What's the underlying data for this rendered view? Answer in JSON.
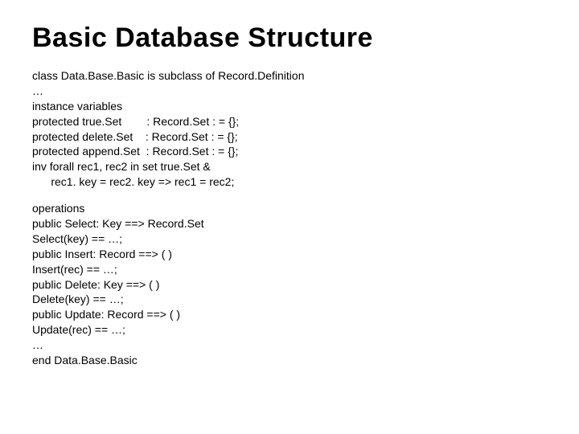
{
  "title": "Basic Database Structure",
  "block1": "class Data.Base.Basic is subclass of Record.Definition\n…\ninstance variables\nprotected true.Set        : Record.Set : = {};\nprotected delete.Set    : Record.Set : = {};\nprotected append.Set  : Record.Set : = {};\ninv forall rec1, rec2 in set true.Set &\n      rec1. key = rec2. key => rec1 = rec2;",
  "block2": "operations\npublic Select: Key ==> Record.Set\nSelect(key) == …;\npublic Insert: Record ==> ( )\nInsert(rec) == …;\npublic Delete: Key ==> ( )\nDelete(key) == …;\npublic Update: Record ==> ( )\nUpdate(rec) == …;\n…\nend Data.Base.Basic"
}
